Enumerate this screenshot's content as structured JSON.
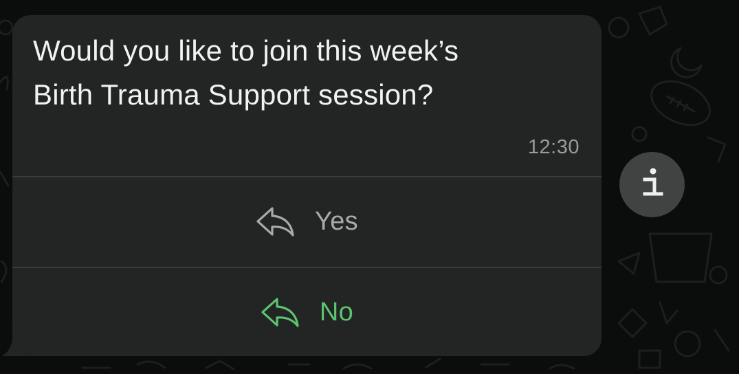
{
  "message": {
    "text_line1": "Would you like to join this week’s",
    "text_line2": "Birth Trauma Support session?",
    "timestamp": "12:30"
  },
  "quick_replies": [
    {
      "label": "Yes",
      "icon": "reply-arrow-icon",
      "color": "#a9abaa"
    },
    {
      "label": "No",
      "icon": "reply-arrow-icon",
      "color": "#5cc471"
    }
  ],
  "info_button": {
    "icon": "info-icon"
  },
  "colors": {
    "background": "#0b0c0c",
    "bubble": "#222524",
    "divider": "#3a3d3c",
    "text": "#f2f2f2",
    "timestamp": "#9a9c9b",
    "accent_green": "#5cc471",
    "info_circle": "#404342"
  }
}
